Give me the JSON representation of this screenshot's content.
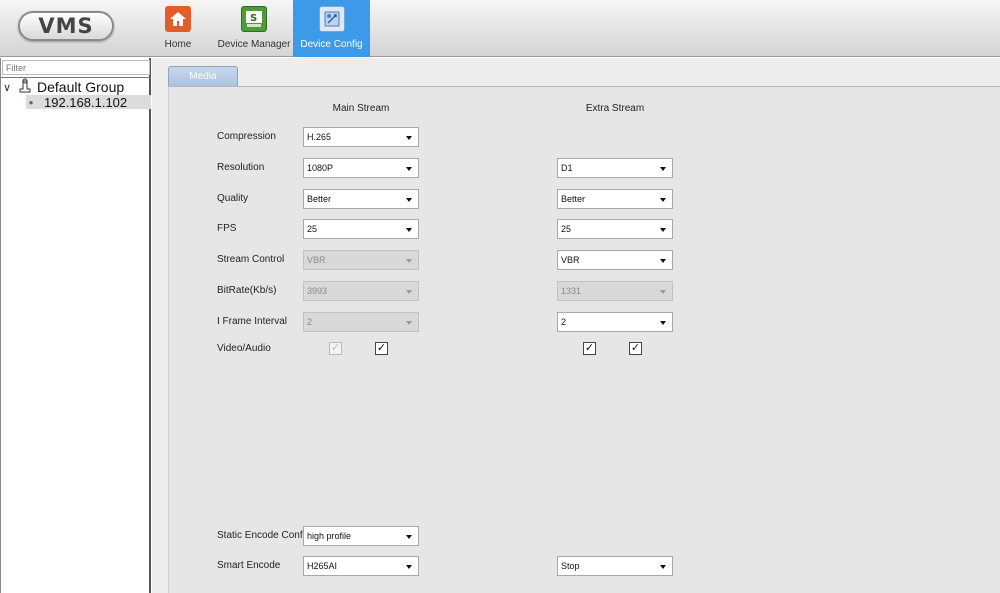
{
  "app": {
    "logo": "VMS"
  },
  "nav": {
    "home": "Home",
    "device_manager": "Device Manager",
    "device_config": "Device Config"
  },
  "sidebar": {
    "filter_placeholder": "Filter",
    "group": "Default Group",
    "device": "192.168.1.102"
  },
  "tabs": [
    {
      "label": "Media",
      "active": true
    }
  ],
  "columns": {
    "main": "Main Stream",
    "extra": "Extra Stream"
  },
  "rows": {
    "compression": {
      "label": "Compression",
      "main": "H.265"
    },
    "resolution": {
      "label": "Resolution",
      "main": "1080P",
      "extra": "D1"
    },
    "quality": {
      "label": "Quality",
      "main": "Better",
      "extra": "Better"
    },
    "fps": {
      "label": "FPS",
      "main": "25",
      "extra": "25"
    },
    "stream_control": {
      "label": "Stream Control",
      "main": "VBR",
      "extra": "VBR"
    },
    "bitrate": {
      "label": "BitRate(Kb/s)",
      "main": "3993",
      "extra": "1331"
    },
    "iframe": {
      "label": "I Frame Interval",
      "main": "2",
      "extra": "2"
    },
    "video_audio": {
      "label": "Video/Audio",
      "main_video": true,
      "main_audio": true,
      "extra_video": true,
      "extra_audio": true
    },
    "static_encode": {
      "label": "Static Encode Config",
      "main": "high profile"
    },
    "smart_encode": {
      "label": "Smart Encode",
      "main": "H265AI",
      "extra": "Stop"
    }
  },
  "colors": {
    "nav_active": "#3d9ae8",
    "tab": "#b4cae3"
  }
}
